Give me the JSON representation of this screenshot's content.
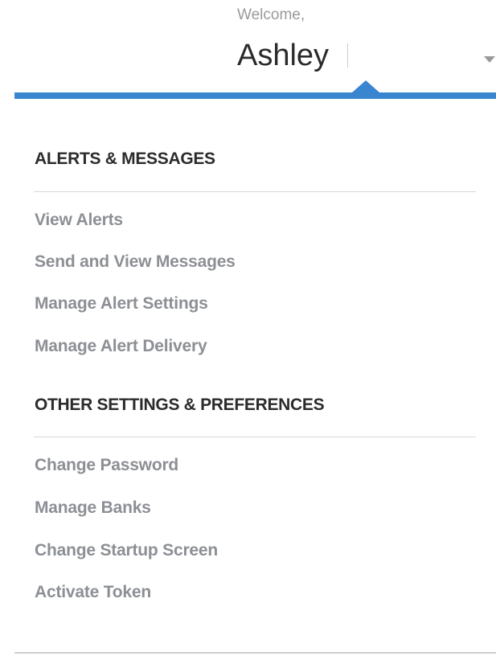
{
  "header": {
    "welcome_text": "Welcome,",
    "user_name": "Ashley",
    "accent_color": "#3a85d0"
  },
  "menu": {
    "sections": [
      {
        "title": "ALERTS & MESSAGES",
        "items": [
          "View Alerts",
          "Send and View Messages",
          "Manage Alert Settings",
          "Manage Alert Delivery"
        ]
      },
      {
        "title": "OTHER SETTINGS & PREFERENCES",
        "items": [
          "Change Password",
          "Manage Banks",
          "Change Startup Screen",
          "Activate Token"
        ]
      }
    ]
  }
}
